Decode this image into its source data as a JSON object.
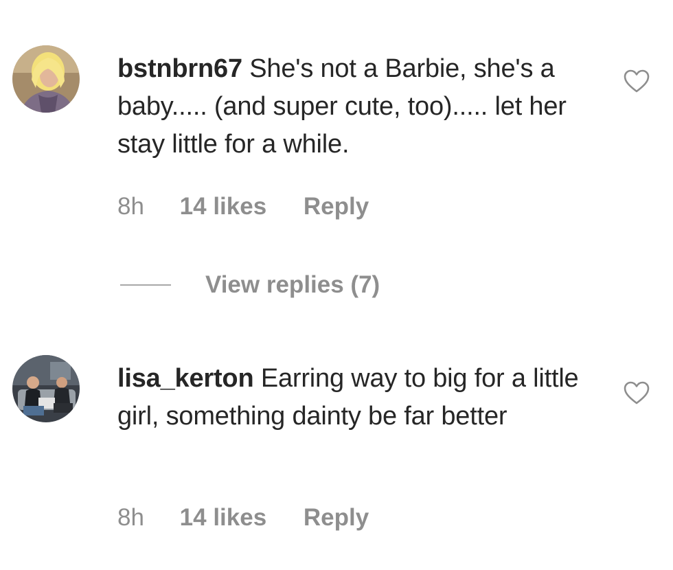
{
  "comments": [
    {
      "username": "bstnbrn67",
      "text": "She's not a Barbie, she's a baby..... (and super cute, too)..... let her stay little for a while.",
      "time": "8h",
      "likes": "14 likes",
      "reply_label": "Reply",
      "icon": "heart-outline-icon"
    },
    {
      "username": "lisa_kerton",
      "text": "Earring way to big for a little girl, something dainty be far better",
      "time": "8h",
      "likes": "14 likes",
      "reply_label": "Reply",
      "icon": "heart-outline-icon"
    }
  ],
  "view_replies": {
    "label": "View replies (7)"
  },
  "colors": {
    "text_primary": "#262626",
    "text_secondary": "#8e8e8e",
    "background": "#ffffff"
  }
}
